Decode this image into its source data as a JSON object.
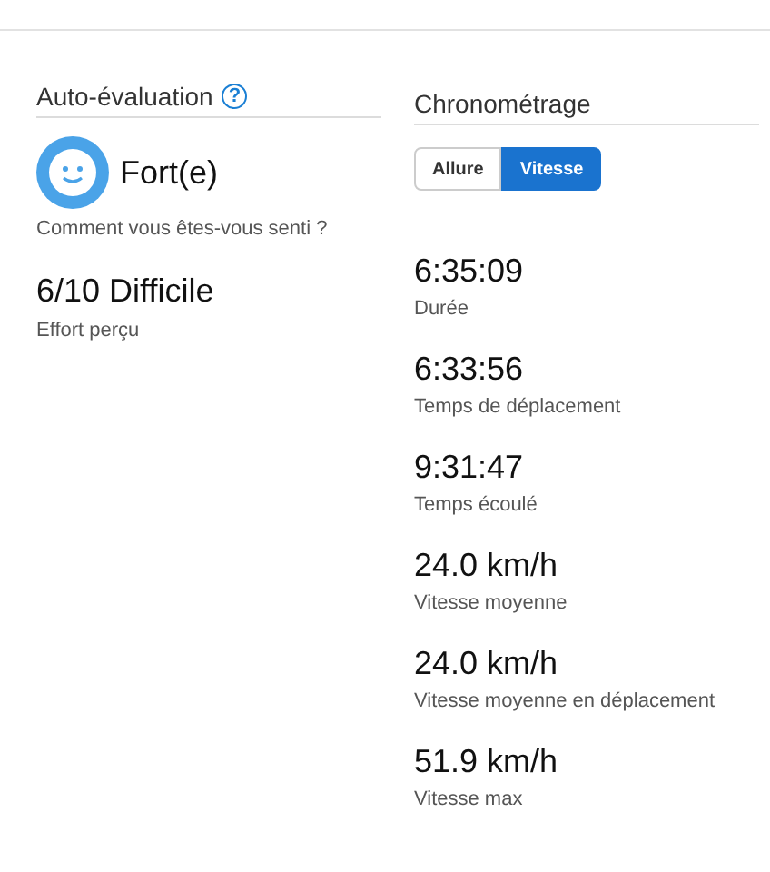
{
  "self_evaluation": {
    "title": "Auto-évaluation",
    "help": "?",
    "feeling": "Fort(e)",
    "feeling_caption": "Comment vous êtes-vous senti ?",
    "effort": "6/10 Difficile",
    "effort_caption": "Effort perçu"
  },
  "timing": {
    "title": "Chronométrage",
    "toggle": [
      {
        "label": "Allure",
        "selected": false
      },
      {
        "label": "Vitesse",
        "selected": true
      }
    ],
    "metrics": [
      {
        "value": "6:35:09",
        "label": "Durée"
      },
      {
        "value": "6:33:56",
        "label": "Temps de déplacement"
      },
      {
        "value": "9:31:47",
        "label": "Temps écoulé"
      },
      {
        "value": "24.0 km/h",
        "label": "Vitesse moyenne"
      },
      {
        "value": "24.0 km/h",
        "label": "Vitesse moyenne en déplacement"
      },
      {
        "value": "51.9 km/h",
        "label": "Vitesse max"
      }
    ]
  }
}
